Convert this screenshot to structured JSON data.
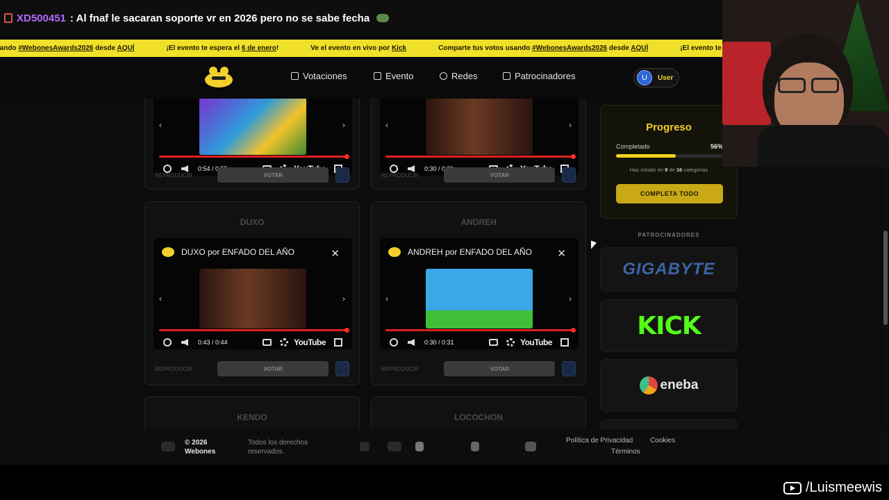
{
  "chat": {
    "username": "XD500451",
    "message": ": Al fnaf le sacaran soporte vr en 2026 pero no se sabe fecha"
  },
  "ticker": {
    "items": [
      {
        "pre": "usando ",
        "hl": "#WebonesAwards2026",
        "mid": " desde ",
        "hl2": "AQUÍ"
      },
      {
        "pre": "¡El evento te espera el ",
        "hl": "6 de enero",
        "mid": "!",
        "hl2": ""
      },
      {
        "pre": "Ve el evento en vivo por ",
        "hl": "Kick",
        "mid": "",
        "hl2": ""
      },
      {
        "pre": "Comparte tus votos usando ",
        "hl": "#WebonesAwards2026",
        "mid": " desde ",
        "hl2": "AQUÍ"
      },
      {
        "pre": "¡El evento te espera el ",
        "hl": "",
        "mid": "",
        "hl2": ""
      }
    ]
  },
  "nav": {
    "items": [
      "Votaciones",
      "Evento",
      "Redes",
      "Patrocinadores"
    ],
    "user_initial": "U",
    "user_label": "User"
  },
  "cards": [
    {
      "title": "",
      "modal_title": "",
      "time": "0:54 / 0:55",
      "play": "REPRODUCIR",
      "vote": "VOTAR"
    },
    {
      "title": "",
      "modal_title": "",
      "time": "0:30 / 0:31",
      "play": "REPRODUCIR",
      "vote": "VOTAR"
    },
    {
      "title": "DUXO",
      "modal_title": "DUXO por ENFADO DEL AÑO",
      "time": "0:43 / 0:44",
      "play": "REPRODUCIR",
      "vote": "VOTAR"
    },
    {
      "title": "ANDREH",
      "modal_title": "ANDREH por ENFADO DEL AÑO",
      "time": "0:30 / 0:31",
      "play": "REPRODUCIR",
      "vote": "VOTAR"
    },
    {
      "title": "KENDO"
    },
    {
      "title": "LOCOCHON"
    }
  ],
  "youtube_label": "YouTube",
  "progress": {
    "title": "Progreso",
    "label": "Completado",
    "percent_text": "56%",
    "percent": 56,
    "voted": "9",
    "total": "16",
    "summary_pre": "Has votado en ",
    "summary_mid": " de ",
    "summary_post": " categorías",
    "button": "COMPLETA TODO"
  },
  "sponsors": {
    "heading": "PATROCINADORES",
    "items": [
      "GIGABYTE",
      "KICK",
      "eneba"
    ]
  },
  "footer": {
    "copyright": "© 2026 Webones",
    "rights": "Todos los derechos reservados.",
    "privacy": "Política de Privacidad",
    "cookies": "Cookies",
    "terms": "Términos"
  },
  "streamer_handle": "/Luismeewis",
  "colors": {
    "accent": "#f3cf2c",
    "ticker": "#f1e02a",
    "kick": "#53fc18",
    "chat_user": "#b36bff"
  }
}
